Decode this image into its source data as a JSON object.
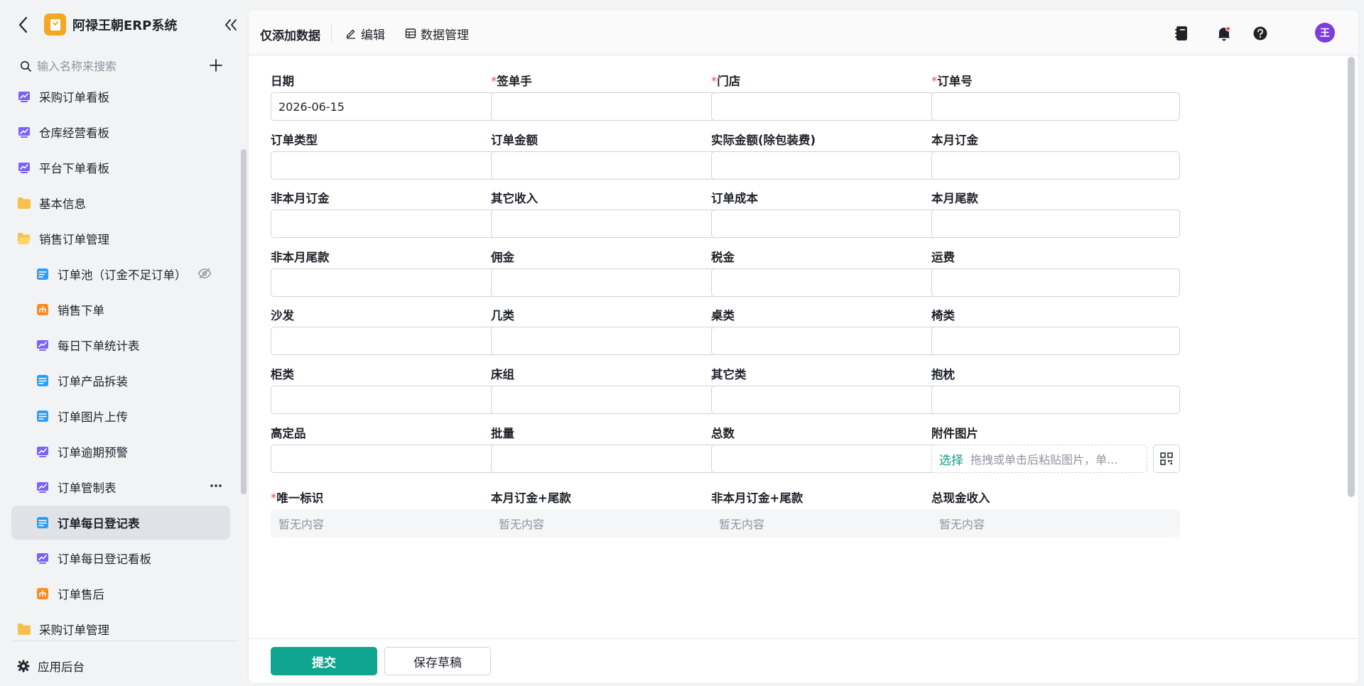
{
  "app": {
    "title": "阿禄王朝ERP系统"
  },
  "sidebar": {
    "search_placeholder": "输入名称来搜索",
    "items": [
      {
        "label": "采购订单看板",
        "icon": "dashboard-icon"
      },
      {
        "label": "仓库经营看板",
        "icon": "dashboard-icon"
      },
      {
        "label": "平台下单看板",
        "icon": "dashboard-icon"
      },
      {
        "label": "基本信息",
        "icon": "folder-icon"
      },
      {
        "label": "销售订单管理",
        "icon": "folder-open-icon"
      },
      {
        "label": "订单池（订金不足订单）",
        "icon": "form-icon"
      },
      {
        "label": "销售下单",
        "icon": "flow-icon"
      },
      {
        "label": "每日下单统计表",
        "icon": "dashboard-icon"
      },
      {
        "label": "订单产品拆装",
        "icon": "table-icon"
      },
      {
        "label": "订单图片上传",
        "icon": "table-icon"
      },
      {
        "label": "订单逾期预警",
        "icon": "dashboard-icon"
      },
      {
        "label": "订单管制表",
        "icon": "dashboard-icon"
      },
      {
        "label": "订单每日登记表",
        "icon": "table-icon"
      },
      {
        "label": "订单每日登记看板",
        "icon": "dashboard-icon"
      },
      {
        "label": "订单售后",
        "icon": "flow-icon"
      },
      {
        "label": "采购订单管理",
        "icon": "folder-icon"
      }
    ],
    "footer_label": "应用后台"
  },
  "toolbar": {
    "title": "仅添加数据",
    "edit_label": "编辑",
    "data_manage_label": "数据管理",
    "avatar_text": "王"
  },
  "form": {
    "fields": [
      {
        "label": "日期",
        "required": "",
        "value": "2026-06-15",
        "kind": "date"
      },
      {
        "label": "签单手",
        "required": "*",
        "value": "",
        "kind": "select"
      },
      {
        "label": "门店",
        "required": "*",
        "value": "",
        "kind": "select"
      },
      {
        "label": "订单号",
        "required": "*",
        "value": "",
        "kind": "text"
      },
      {
        "label": "订单类型",
        "required": "",
        "value": "",
        "kind": "select"
      },
      {
        "label": "订单金额",
        "required": "",
        "value": "",
        "kind": "text"
      },
      {
        "label": "实际金额(除包装费)",
        "required": "",
        "value": "",
        "kind": "text"
      },
      {
        "label": "本月订金",
        "required": "",
        "value": "",
        "kind": "text"
      },
      {
        "label": "非本月订金",
        "required": "",
        "value": "",
        "kind": "text"
      },
      {
        "label": "其它收入",
        "required": "",
        "value": "",
        "kind": "text"
      },
      {
        "label": "订单成本",
        "required": "",
        "value": "",
        "kind": "text"
      },
      {
        "label": "本月尾款",
        "required": "",
        "value": "",
        "kind": "text"
      },
      {
        "label": "非本月尾款",
        "required": "",
        "value": "",
        "kind": "text"
      },
      {
        "label": "佣金",
        "required": "",
        "value": "",
        "kind": "text"
      },
      {
        "label": "税金",
        "required": "",
        "value": "",
        "kind": "text"
      },
      {
        "label": "运费",
        "required": "",
        "value": "",
        "kind": "text"
      },
      {
        "label": "沙发",
        "required": "",
        "value": "",
        "kind": "text"
      },
      {
        "label": "几类",
        "required": "",
        "value": "",
        "kind": "text"
      },
      {
        "label": "桌类",
        "required": "",
        "value": "",
        "kind": "text"
      },
      {
        "label": "椅类",
        "required": "",
        "value": "",
        "kind": "text"
      },
      {
        "label": "柜类",
        "required": "",
        "value": "",
        "kind": "text"
      },
      {
        "label": "床组",
        "required": "",
        "value": "",
        "kind": "text"
      },
      {
        "label": "其它类",
        "required": "",
        "value": "",
        "kind": "text"
      },
      {
        "label": "抱枕",
        "required": "",
        "value": "",
        "kind": "text"
      },
      {
        "label": "高定品",
        "required": "",
        "value": "",
        "kind": "text"
      },
      {
        "label": "批量",
        "required": "",
        "value": "",
        "kind": "text"
      },
      {
        "label": "总数",
        "required": "",
        "value": "",
        "kind": "text"
      },
      {
        "label": "附件图片",
        "required": "",
        "value": "",
        "kind": "upload"
      },
      {
        "label": "唯一标识",
        "required": "*",
        "value": "暂无内容",
        "kind": "readonly"
      },
      {
        "label": "本月订金+尾款",
        "required": "",
        "value": "暂无内容",
        "kind": "readonly"
      },
      {
        "label": "非本月订金+尾款",
        "required": "",
        "value": "暂无内容",
        "kind": "readonly"
      },
      {
        "label": "总现金收入",
        "required": "",
        "value": "暂无内容",
        "kind": "readonly"
      }
    ],
    "upload_choose": "选择",
    "upload_hint": "拖拽或单击后粘贴图片，单..."
  },
  "footer": {
    "submit_label": "提交",
    "draft_label": "保存草稿"
  },
  "colors": {
    "accent": "#10a58f",
    "required": "#f54a45",
    "avatar": "#7b3ddb",
    "logo": "#f5a623"
  }
}
